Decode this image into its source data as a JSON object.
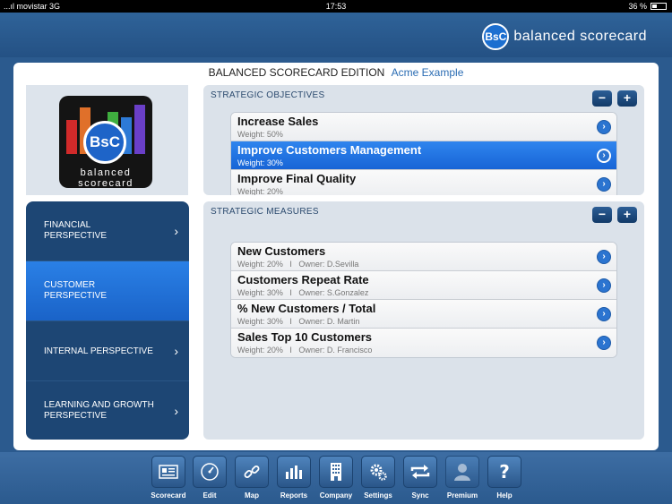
{
  "statusbar": {
    "carrier": "...ıl movistar  3G",
    "time": "17:53",
    "battery": "36 %",
    "battery_level": 0.36
  },
  "brand": {
    "logo_mark": "BsC",
    "logo_text": "balanced scorecard"
  },
  "header": {
    "edition": "BALANCED SCORECARD EDITION",
    "company": "Acme Example"
  },
  "app_icon": {
    "mark": "BsC",
    "line1": "balanced",
    "line2": "scorecard"
  },
  "perspectives": [
    {
      "label": "FINANCIAL\nPERSPECTIVE",
      "active": false
    },
    {
      "label": "CUSTOMER\nPERSPECTIVE",
      "active": true
    },
    {
      "label": "INTERNAL PERSPECTIVE",
      "active": false
    },
    {
      "label": "LEARNING AND GROWTH\nPERSPECTIVE",
      "active": false
    }
  ],
  "objectives": {
    "title": "STRATEGIC OBJECTIVES",
    "minus": "−",
    "plus": "+",
    "items": [
      {
        "name": "Increase Sales",
        "sub": "Weight: 50%"
      },
      {
        "name": "Improve Customers Management",
        "sub": "Weight: 30%"
      },
      {
        "name": "Improve Final Quality",
        "sub": "Weight: 20%"
      }
    ]
  },
  "measures": {
    "title": "STRATEGIC MEASURES",
    "minus": "−",
    "plus": "+",
    "items": [
      {
        "name": "New Customers",
        "sub": "Weight: 20%   I   Owner: D.Sevilla"
      },
      {
        "name": "Customers Repeat Rate",
        "sub": "Weight: 30%   I   Owner: S.Gonzalez"
      },
      {
        "name": "% New Customers / Total",
        "sub": "Weight: 30%   I   Owner: D. Martin"
      },
      {
        "name": "Sales Top 10 Customers",
        "sub": "Weight: 20%   I   Owner: D. Francisco"
      }
    ]
  },
  "toolbar": [
    {
      "label": "Scorecard",
      "icon": "scorecard-icon"
    },
    {
      "label": "Edit",
      "icon": "gauge-icon"
    },
    {
      "label": "Map",
      "icon": "link-icon"
    },
    {
      "label": "Reports",
      "icon": "bar-chart-icon"
    },
    {
      "label": "Company",
      "icon": "building-icon"
    },
    {
      "label": "Settings",
      "icon": "gears-icon"
    },
    {
      "label": "Sync",
      "icon": "sync-icon"
    },
    {
      "label": "Premium",
      "icon": "user-icon"
    },
    {
      "label": "Help",
      "icon": "help-icon"
    }
  ],
  "colors": {
    "accent": "#1a63c8",
    "toolbar": "#2b5a8e",
    "nav": "#1d4674"
  }
}
